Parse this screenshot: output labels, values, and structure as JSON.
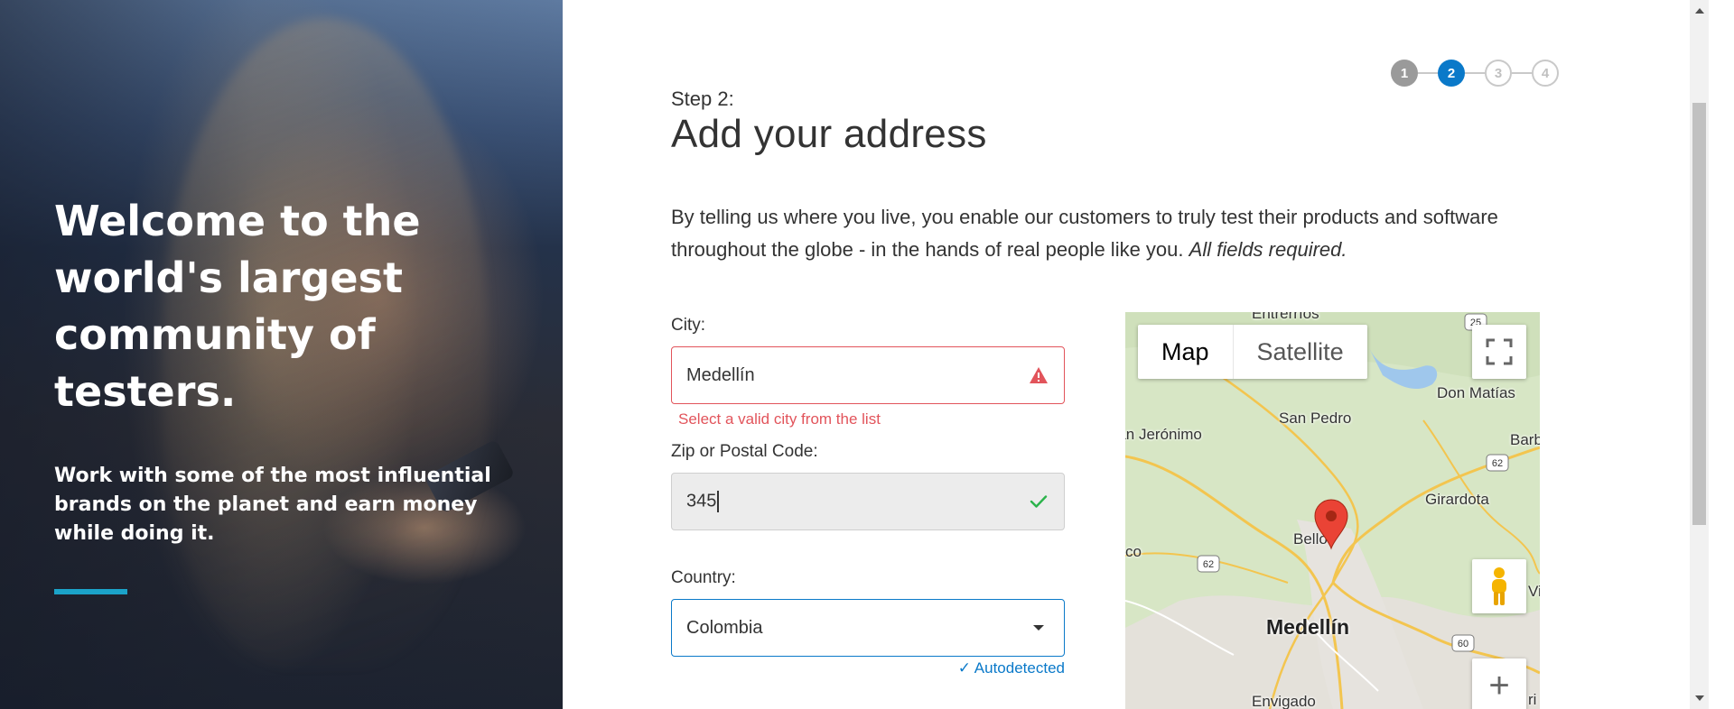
{
  "hero": {
    "title": "Welcome to the world's largest community of testers.",
    "subtitle": "Work with some of the most influential brands on the planet and earn money while doing it.",
    "accent_color": "#1ba3c9"
  },
  "stepper": {
    "steps": [
      "1",
      "2",
      "3",
      "4"
    ],
    "current": 2
  },
  "form": {
    "step_label": "Step 2:",
    "title": "Add your address",
    "intro": "By telling us where you live, you enable our customers to truly test their products and software throughout the globe - in the hands of real people like you.",
    "intro_emphasis": "All fields required.",
    "city": {
      "label": "City:",
      "value": "Medellín",
      "status": "error",
      "status_icon": "warning-icon",
      "error": "Select a valid city from the list"
    },
    "zip": {
      "label": "Zip or Postal Code:",
      "value": "345",
      "status": "valid",
      "status_icon": "check-icon"
    },
    "country": {
      "label": "Country:",
      "value": "Colombia",
      "note": "✓ Autodetected"
    }
  },
  "map": {
    "type_options": [
      "Map",
      "Satellite"
    ],
    "selected_type": "Map",
    "zoom_in": "+",
    "labels": [
      "Entrerríos",
      "Don Matías",
      "San Pedro",
      "San Jerónimo",
      "Girardota",
      "Bello",
      "Medellín",
      "Envigado",
      "Barbosa",
      "co",
      "Vi",
      "ri"
    ],
    "route_shields": [
      "25",
      "62",
      "62",
      "60"
    ]
  },
  "colors": {
    "error": "#e2545b",
    "success": "#2bb34b",
    "primary": "#0a79c9"
  }
}
